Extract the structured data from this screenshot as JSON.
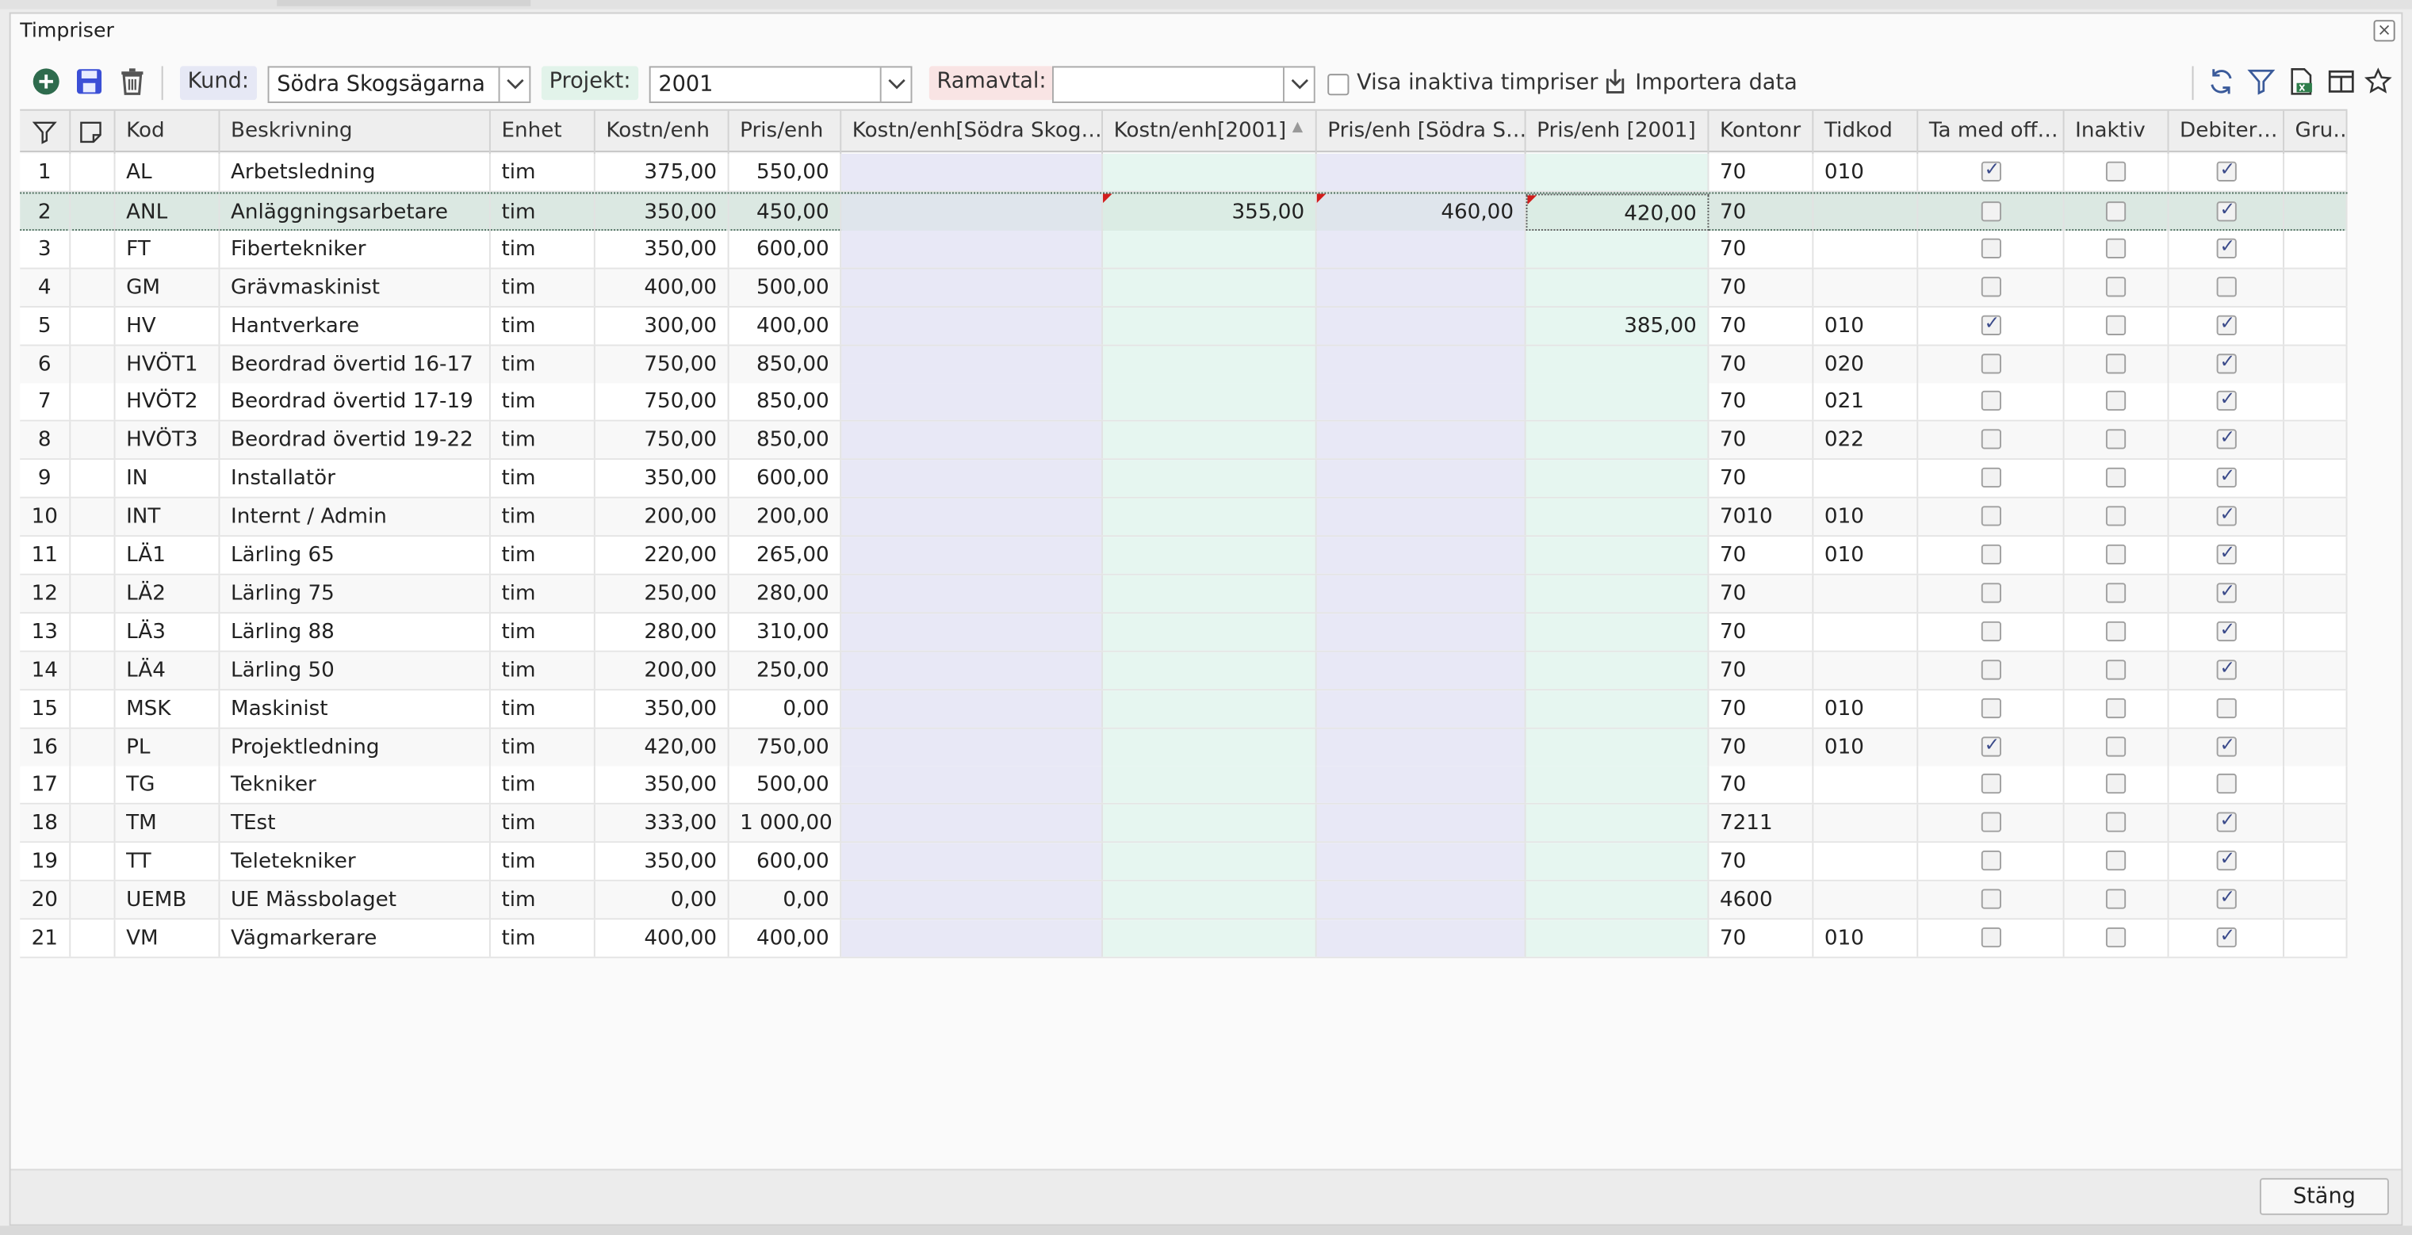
{
  "window": {
    "title": "Timpriser",
    "close_label": "×"
  },
  "toolbar": {
    "kund_label": "Kund:",
    "kund_value": "Södra Skogsägarna",
    "projekt_label": "Projekt:",
    "projekt_value": "2001",
    "ramavtal_label": "Ramavtal:",
    "ramavtal_value": "",
    "visa_inaktiva_label": "Visa inaktiva timpriser",
    "importera_label": "Importera data"
  },
  "columns": [
    "Kod",
    "Beskrivning",
    "Enhet",
    "Kostn/enh",
    "Pris/enh",
    "Kostn/enh[Södra Skog…",
    "Kostn/enh[2001]",
    "Pris/enh [Södra S…",
    "Pris/enh [2001]",
    "Kontonr",
    "Tidkod",
    "Ta med off…",
    "Inaktiv",
    "Debiter…",
    "Gru…"
  ],
  "sort_indicator": "▲",
  "rows": [
    {
      "n": "1",
      "kod": "AL",
      "besk": "Arbetsledning",
      "enhet": "tim",
      "kostn": "375,00",
      "pris": "550,00",
      "k_kund": "",
      "k_proj": "",
      "p_kund": "",
      "p_proj": "",
      "konto": "70",
      "tidkod": "010",
      "tamed": true,
      "inaktiv": false,
      "debit": true
    },
    {
      "n": "2",
      "kod": "ANL",
      "besk": "Anläggningsarbetare",
      "enhet": "tim",
      "kostn": "350,00",
      "pris": "450,00",
      "k_kund": "",
      "k_proj": "355,00",
      "p_kund": "460,00",
      "p_proj": "420,00",
      "konto": "70",
      "tidkod": "",
      "tamed": false,
      "inaktiv": false,
      "debit": true
    },
    {
      "n": "3",
      "kod": "FT",
      "besk": "Fibertekniker",
      "enhet": "tim",
      "kostn": "350,00",
      "pris": "600,00",
      "k_kund": "",
      "k_proj": "",
      "p_kund": "",
      "p_proj": "",
      "konto": "70",
      "tidkod": "",
      "tamed": false,
      "inaktiv": false,
      "debit": true
    },
    {
      "n": "4",
      "kod": "GM",
      "besk": "Grävmaskinist",
      "enhet": "tim",
      "kostn": "400,00",
      "pris": "500,00",
      "k_kund": "",
      "k_proj": "",
      "p_kund": "",
      "p_proj": "",
      "konto": "70",
      "tidkod": "",
      "tamed": false,
      "inaktiv": false,
      "debit": false
    },
    {
      "n": "5",
      "kod": "HV",
      "besk": "Hantverkare",
      "enhet": "tim",
      "kostn": "300,00",
      "pris": "400,00",
      "k_kund": "",
      "k_proj": "",
      "p_kund": "",
      "p_proj": "385,00",
      "konto": "70",
      "tidkod": "010",
      "tamed": true,
      "inaktiv": false,
      "debit": true
    },
    {
      "n": "6",
      "kod": "HVÖT1",
      "besk": "Beordrad övertid 16-17",
      "enhet": "tim",
      "kostn": "750,00",
      "pris": "850,00",
      "k_kund": "",
      "k_proj": "",
      "p_kund": "",
      "p_proj": "",
      "konto": "70",
      "tidkod": "020",
      "tamed": false,
      "inaktiv": false,
      "debit": true
    },
    {
      "n": "7",
      "kod": "HVÖT2",
      "besk": "Beordrad övertid 17-19",
      "enhet": "tim",
      "kostn": "750,00",
      "pris": "850,00",
      "k_kund": "",
      "k_proj": "",
      "p_kund": "",
      "p_proj": "",
      "konto": "70",
      "tidkod": "021",
      "tamed": false,
      "inaktiv": false,
      "debit": true
    },
    {
      "n": "8",
      "kod": "HVÖT3",
      "besk": "Beordrad övertid 19-22",
      "enhet": "tim",
      "kostn": "750,00",
      "pris": "850,00",
      "k_kund": "",
      "k_proj": "",
      "p_kund": "",
      "p_proj": "",
      "konto": "70",
      "tidkod": "022",
      "tamed": false,
      "inaktiv": false,
      "debit": true
    },
    {
      "n": "9",
      "kod": "IN",
      "besk": "Installatör",
      "enhet": "tim",
      "kostn": "350,00",
      "pris": "600,00",
      "k_kund": "",
      "k_proj": "",
      "p_kund": "",
      "p_proj": "",
      "konto": "70",
      "tidkod": "",
      "tamed": false,
      "inaktiv": false,
      "debit": true
    },
    {
      "n": "10",
      "kod": "INT",
      "besk": "Internt / Admin",
      "enhet": "tim",
      "kostn": "200,00",
      "pris": "200,00",
      "k_kund": "",
      "k_proj": "",
      "p_kund": "",
      "p_proj": "",
      "konto": "7010",
      "tidkod": "010",
      "tamed": false,
      "inaktiv": false,
      "debit": true
    },
    {
      "n": "11",
      "kod": "LÄ1",
      "besk": "Lärling 65",
      "enhet": "tim",
      "kostn": "220,00",
      "pris": "265,00",
      "k_kund": "",
      "k_proj": "",
      "p_kund": "",
      "p_proj": "",
      "konto": "70",
      "tidkod": "010",
      "tamed": false,
      "inaktiv": false,
      "debit": true
    },
    {
      "n": "12",
      "kod": "LÄ2",
      "besk": "Lärling 75",
      "enhet": "tim",
      "kostn": "250,00",
      "pris": "280,00",
      "k_kund": "",
      "k_proj": "",
      "p_kund": "",
      "p_proj": "",
      "konto": "70",
      "tidkod": "",
      "tamed": false,
      "inaktiv": false,
      "debit": true
    },
    {
      "n": "13",
      "kod": "LÄ3",
      "besk": "Lärling 88",
      "enhet": "tim",
      "kostn": "280,00",
      "pris": "310,00",
      "k_kund": "",
      "k_proj": "",
      "p_kund": "",
      "p_proj": "",
      "konto": "70",
      "tidkod": "",
      "tamed": false,
      "inaktiv": false,
      "debit": true
    },
    {
      "n": "14",
      "kod": "LÄ4",
      "besk": "Lärling 50",
      "enhet": "tim",
      "kostn": "200,00",
      "pris": "250,00",
      "k_kund": "",
      "k_proj": "",
      "p_kund": "",
      "p_proj": "",
      "konto": "70",
      "tidkod": "",
      "tamed": false,
      "inaktiv": false,
      "debit": true
    },
    {
      "n": "15",
      "kod": "MSK",
      "besk": "Maskinist",
      "enhet": "tim",
      "kostn": "350,00",
      "pris": "0,00",
      "k_kund": "",
      "k_proj": "",
      "p_kund": "",
      "p_proj": "",
      "konto": "70",
      "tidkod": "010",
      "tamed": false,
      "inaktiv": false,
      "debit": false
    },
    {
      "n": "16",
      "kod": "PL",
      "besk": "Projektledning",
      "enhet": "tim",
      "kostn": "420,00",
      "pris": "750,00",
      "k_kund": "",
      "k_proj": "",
      "p_kund": "",
      "p_proj": "",
      "konto": "70",
      "tidkod": "010",
      "tamed": true,
      "inaktiv": false,
      "debit": true
    },
    {
      "n": "17",
      "kod": "TG",
      "besk": "Tekniker",
      "enhet": "tim",
      "kostn": "350,00",
      "pris": "500,00",
      "k_kund": "",
      "k_proj": "",
      "p_kund": "",
      "p_proj": "",
      "konto": "70",
      "tidkod": "",
      "tamed": false,
      "inaktiv": false,
      "debit": false
    },
    {
      "n": "18",
      "kod": "TM",
      "besk": "TEst",
      "enhet": "tim",
      "kostn": "333,00",
      "pris": "1 000,00",
      "k_kund": "",
      "k_proj": "",
      "p_kund": "",
      "p_proj": "",
      "konto": "7211",
      "tidkod": "",
      "tamed": false,
      "inaktiv": false,
      "debit": true
    },
    {
      "n": "19",
      "kod": "TT",
      "besk": "Teletekniker",
      "enhet": "tim",
      "kostn": "350,00",
      "pris": "600,00",
      "k_kund": "",
      "k_proj": "",
      "p_kund": "",
      "p_proj": "",
      "konto": "70",
      "tidkod": "",
      "tamed": false,
      "inaktiv": false,
      "debit": true
    },
    {
      "n": "20",
      "kod": "UEMB",
      "besk": "UE Mässbolaget",
      "enhet": "tim",
      "kostn": "0,00",
      "pris": "0,00",
      "k_kund": "",
      "k_proj": "",
      "p_kund": "",
      "p_proj": "",
      "konto": "4600",
      "tidkod": "",
      "tamed": false,
      "inaktiv": false,
      "debit": true
    },
    {
      "n": "21",
      "kod": "VM",
      "besk": "Vägmarkerare",
      "enhet": "tim",
      "kostn": "400,00",
      "pris": "400,00",
      "k_kund": "",
      "k_proj": "",
      "p_kund": "",
      "p_proj": "",
      "konto": "70",
      "tidkod": "010",
      "tamed": false,
      "inaktiv": false,
      "debit": true
    }
  ],
  "selected_row": 2,
  "footer": {
    "close_button_label": "Stäng"
  },
  "colors": {
    "accent_green": "#2e6b4d",
    "accent_blue": "#3b4fd6",
    "kund_tint": "#e8e8f6",
    "projekt_tint": "#e6f6f0",
    "ramavtal_tint": "#f9e4e4"
  }
}
